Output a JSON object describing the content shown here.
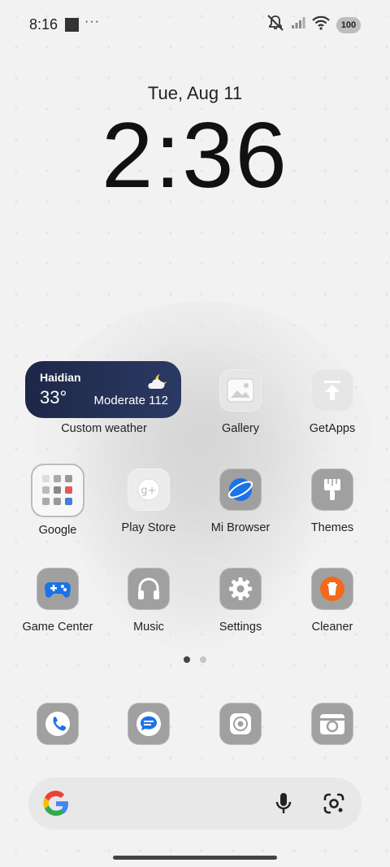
{
  "status_bar": {
    "time": "8:16",
    "dots": "···",
    "battery": "100"
  },
  "lock": {
    "date": "Tue, Aug 11",
    "time": "2:36"
  },
  "weather_widget": {
    "city": "Haidian",
    "temperature": "33°",
    "air_quality": "Moderate 112",
    "label": "Custom weather"
  },
  "apps": [
    {
      "label": "Gallery",
      "icon": "gallery-icon"
    },
    {
      "label": "GetApps",
      "icon": "getapps-icon"
    },
    {
      "label": "Google",
      "icon": "google-folder-icon"
    },
    {
      "label": "Play Store",
      "icon": "play-store-icon"
    },
    {
      "label": "Mi Browser",
      "icon": "mi-browser-icon"
    },
    {
      "label": "Themes",
      "icon": "themes-icon"
    },
    {
      "label": "Game Center",
      "icon": "game-center-icon"
    },
    {
      "label": "Music",
      "icon": "music-icon"
    },
    {
      "label": "Settings",
      "icon": "settings-icon"
    },
    {
      "label": "Cleaner",
      "icon": "cleaner-icon"
    }
  ],
  "dock": [
    {
      "icon": "phone-icon"
    },
    {
      "icon": "messages-icon"
    },
    {
      "icon": "chrome-icon"
    },
    {
      "icon": "camera-icon"
    }
  ],
  "pager": {
    "pages": 2,
    "active": 1
  },
  "colors": {
    "weather_bg": "#1e2748",
    "icon_gray": "#a0a0a0",
    "cleaner_orange": "#f26a1b",
    "blue": "#1a73e8"
  }
}
